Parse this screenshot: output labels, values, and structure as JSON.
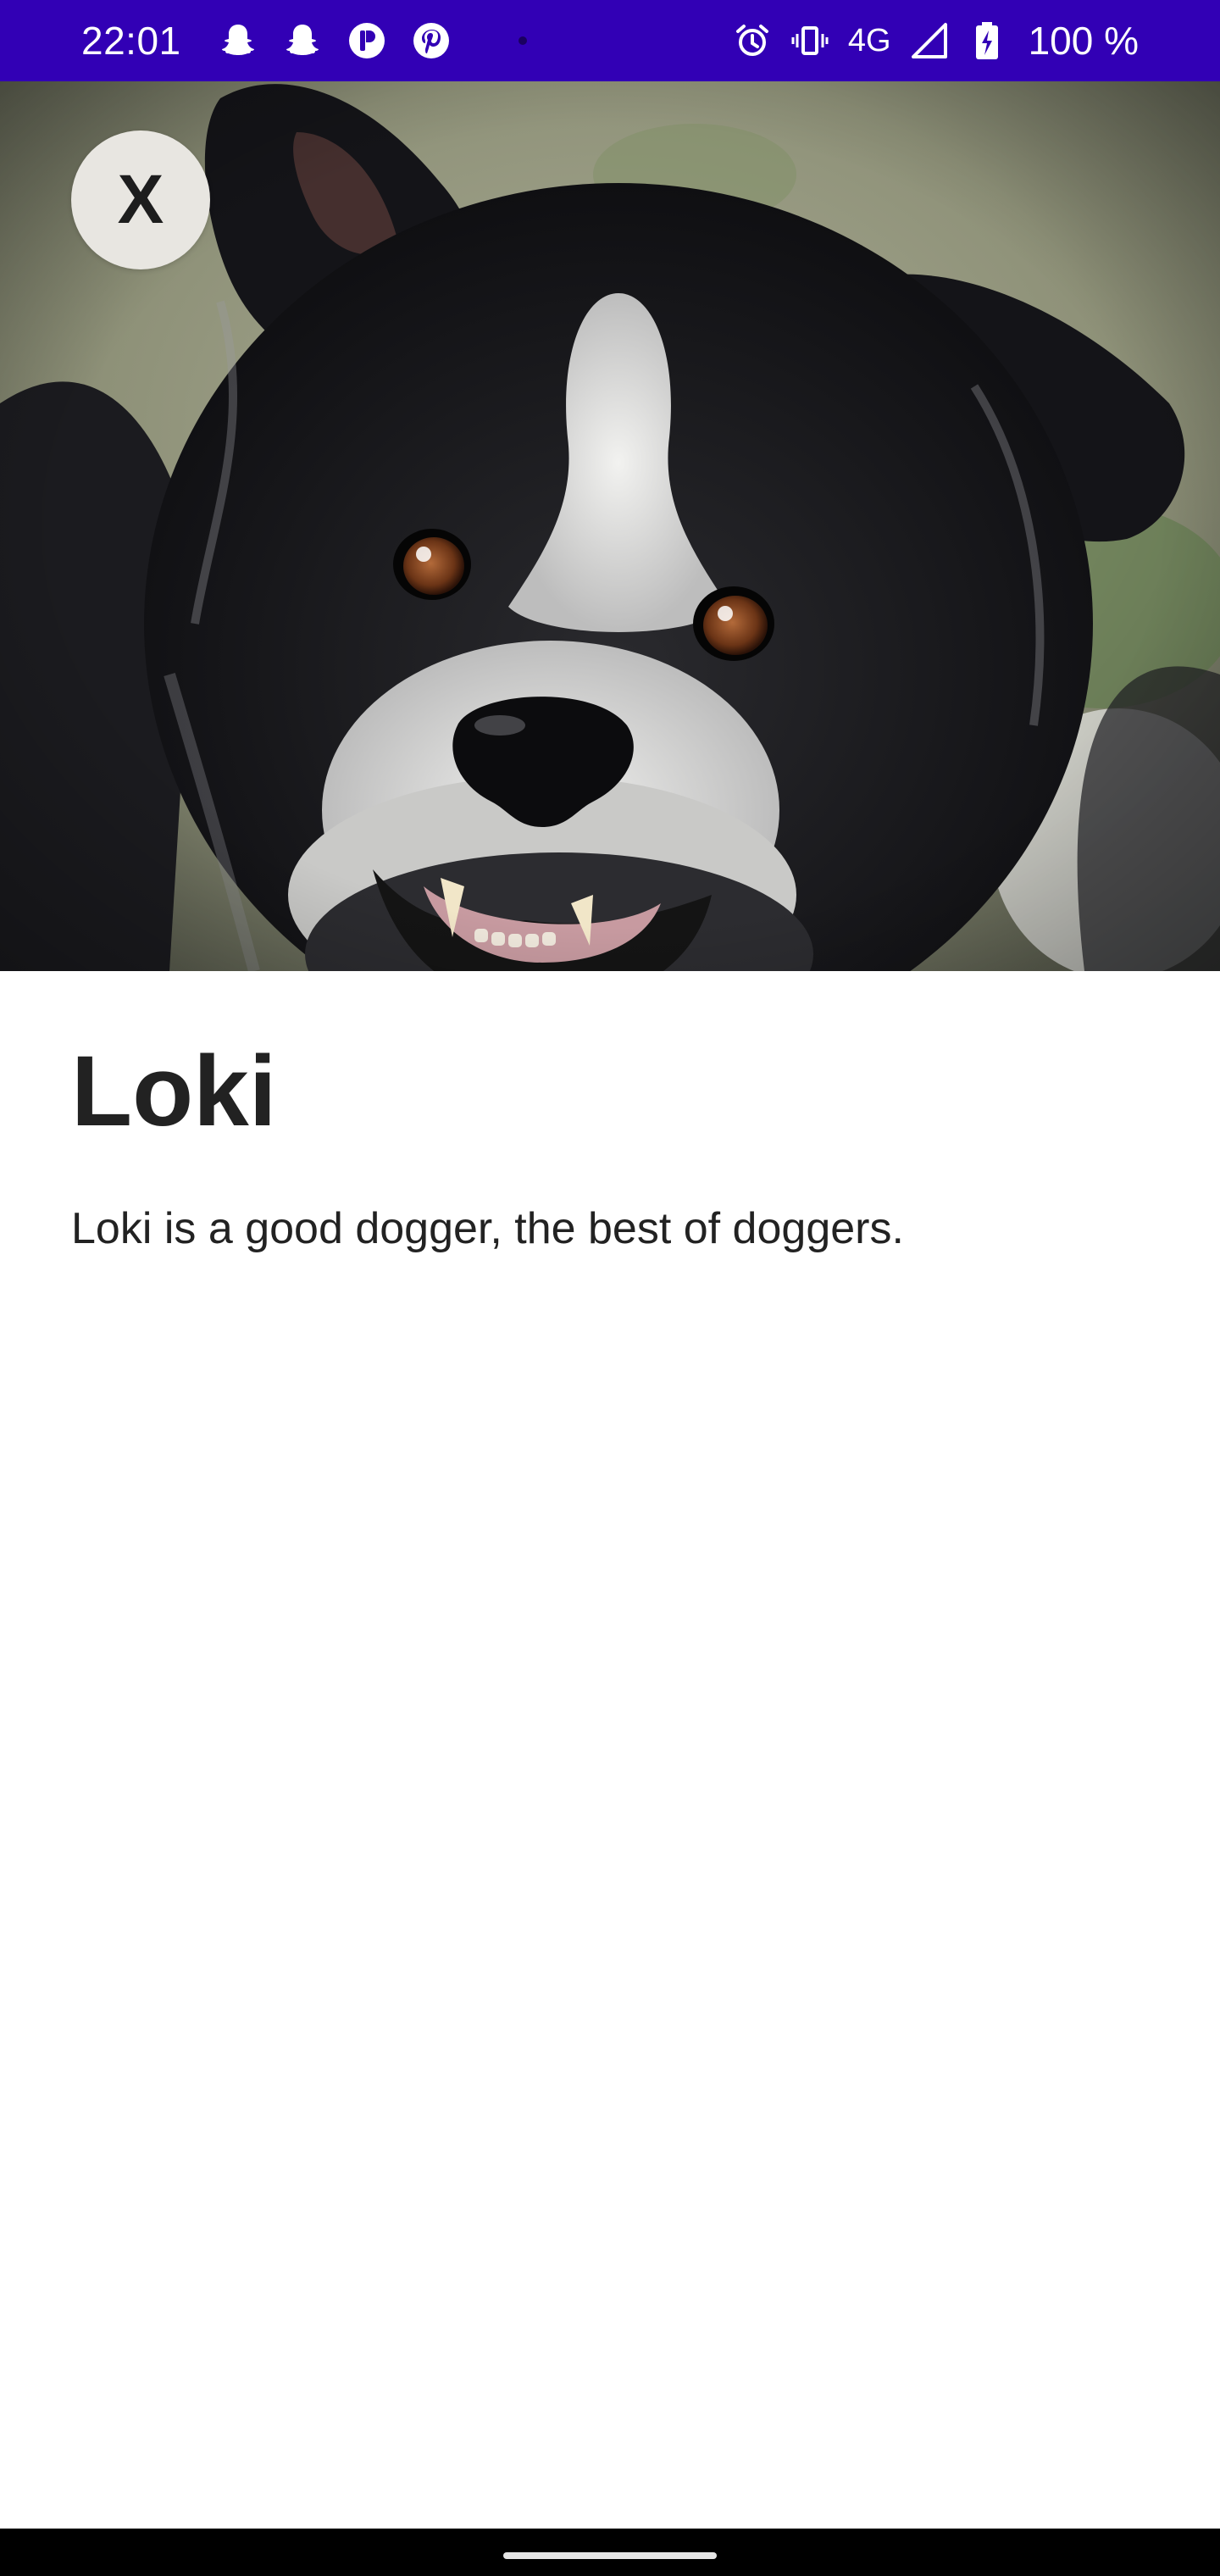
{
  "status_bar": {
    "time": "22:01",
    "notification_icons": [
      "snapchat-ghost-icon",
      "snapchat-ghost-icon",
      "app-p-icon",
      "pinterest-icon"
    ],
    "network": "4G",
    "battery_text": "100 %",
    "background_color": "#3200b5"
  },
  "header": {
    "close_label": "X"
  },
  "pet": {
    "name": "Loki",
    "description": "Loki is a good dogger, the best of doggers."
  }
}
